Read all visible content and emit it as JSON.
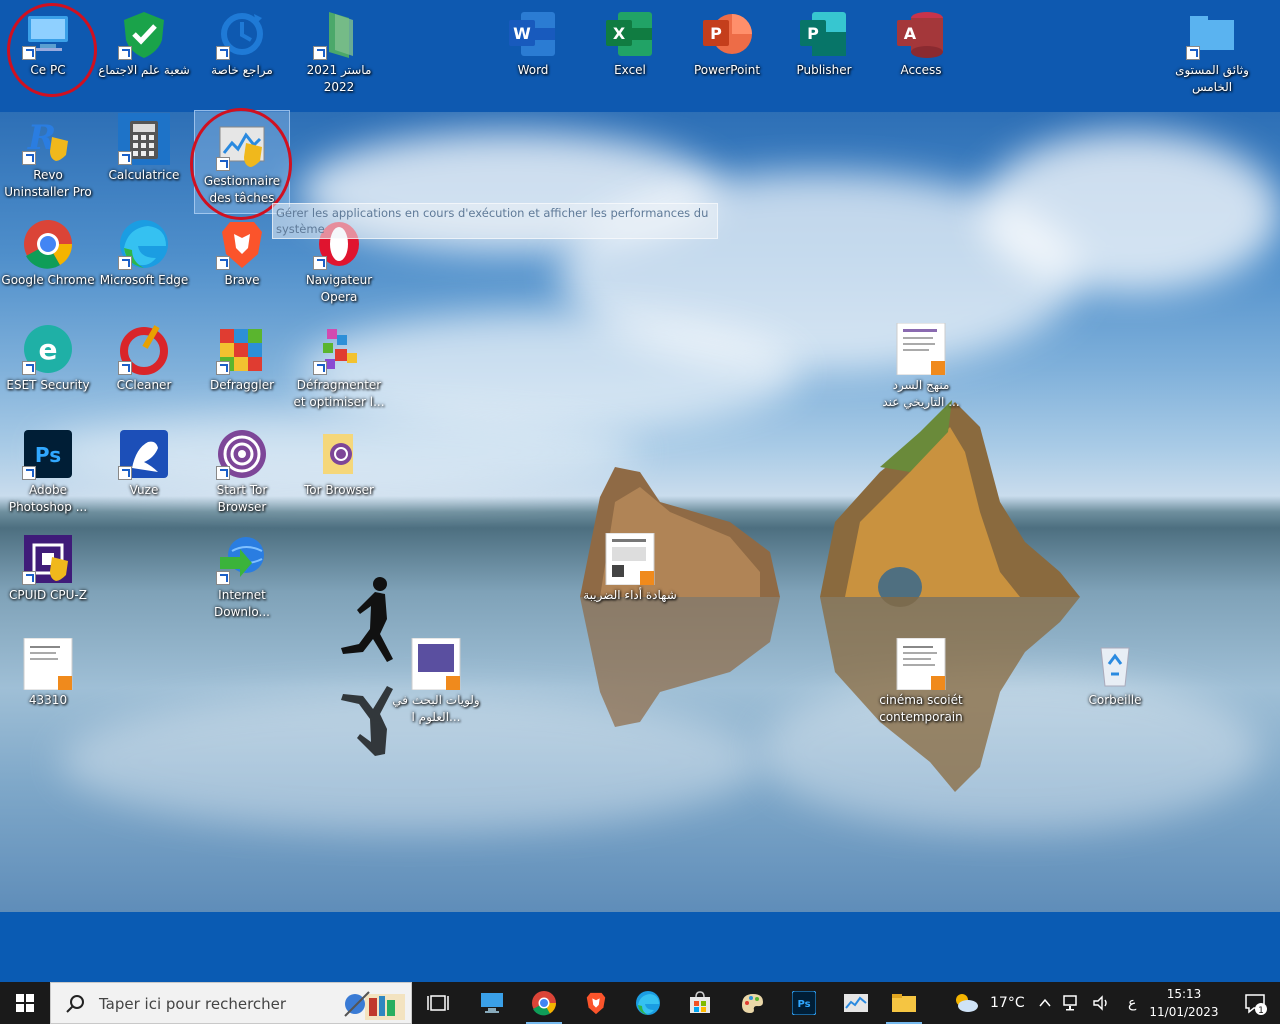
{
  "desktop_icons": [
    {
      "name": "ce-pc",
      "label": "Ce PC"
    },
    {
      "name": "folder-socio",
      "label": "شعبة علم الاجتماع"
    },
    {
      "name": "folder-refs",
      "label": "مراجع خاصة"
    },
    {
      "name": "folder-master",
      "label": "ماستر 2021 2022"
    },
    {
      "name": "word",
      "label": "Word"
    },
    {
      "name": "excel",
      "label": "Excel"
    },
    {
      "name": "powerpoint",
      "label": "PowerPoint"
    },
    {
      "name": "publisher",
      "label": "Publisher"
    },
    {
      "name": "access",
      "label": "Access"
    },
    {
      "name": "folder-docs",
      "label": "وثائق المستوى الخامس"
    },
    {
      "name": "revo",
      "label": "Revo Uninstaller Pro"
    },
    {
      "name": "calculatrice",
      "label": "Calculatrice"
    },
    {
      "name": "taskmgr",
      "label": "Gestionnaire des tâches"
    },
    {
      "name": "chrome",
      "label": "Google Chrome"
    },
    {
      "name": "edge",
      "label": "Microsoft Edge"
    },
    {
      "name": "brave",
      "label": "Brave"
    },
    {
      "name": "opera",
      "label": "Navigateur Opera"
    },
    {
      "name": "eset",
      "label": "ESET Security"
    },
    {
      "name": "ccleaner",
      "label": "CCleaner"
    },
    {
      "name": "defraggler",
      "label": "Defraggler"
    },
    {
      "name": "defrag",
      "label": "Défragmenter et optimiser l..."
    },
    {
      "name": "photoshop",
      "label": "Adobe Photoshop ..."
    },
    {
      "name": "vuze",
      "label": "Vuze"
    },
    {
      "name": "tor-start",
      "label": "Start Tor Browser"
    },
    {
      "name": "tor-folder",
      "label": "Tor Browser"
    },
    {
      "name": "cpuz",
      "label": "CPUID CPU-Z"
    },
    {
      "name": "idm",
      "label": "Internet Downlo..."
    },
    {
      "name": "doc-43310",
      "label": "43310"
    },
    {
      "name": "doc-research",
      "label": "ولويات البحث في العلوم ا..."
    },
    {
      "name": "doc-sard",
      "label": "منهج السرد التاريخي عند ..."
    },
    {
      "name": "doc-shahada",
      "label": "شهادة أداء الضريبة"
    },
    {
      "name": "doc-cinema",
      "label": "cinéma scoiét contemporain"
    },
    {
      "name": "corbeille",
      "label": "Corbeille"
    }
  ],
  "tooltip": {
    "text": "Gérer les applications en cours d'exécution et afficher les performances du système"
  },
  "taskbar": {
    "search_placeholder": "Taper ici pour rechercher",
    "weather": "17°C",
    "lang": "ع",
    "time": "15:13",
    "date": "11/01/2023",
    "notif_count": "1",
    "ps_label": "Ps"
  },
  "colors": {
    "accent": "#0a5bb3",
    "taskbar": "#1a1a1a",
    "highlight": "#d01020"
  }
}
